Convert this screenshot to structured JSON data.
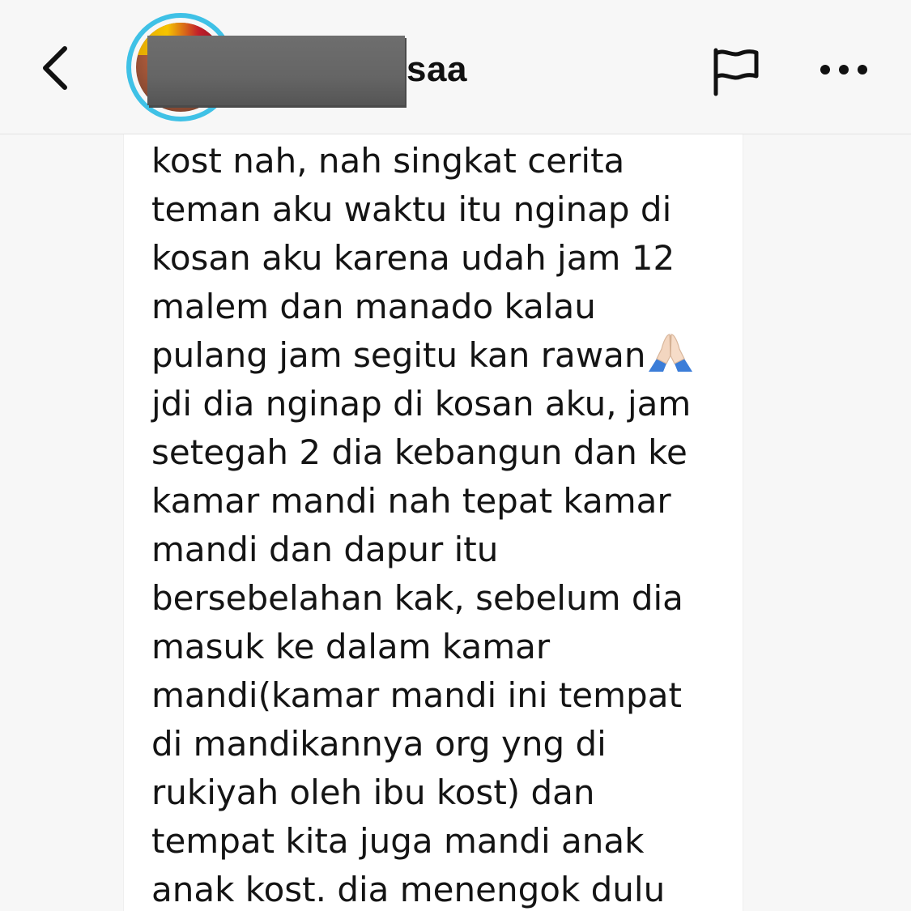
{
  "header": {
    "username_visible_suffix": "saa",
    "back_icon": "chevron-left-icon",
    "flag_icon": "flag-icon",
    "more_icon": "more-horizontal-icon",
    "avatar_ring_color": "#3fc1e6"
  },
  "message": {
    "lines": [
      "kost nah, nah singkat cerita",
      "teman aku waktu itu nginap di",
      "kosan aku karena udah jam 12",
      "malem dan manado kalau",
      "pulang jam segitu kan rawan",
      "jdi dia nginap di kosan aku, jam",
      "setegah 2 dia kebangun dan ke",
      "kamar mandi nah tepat kamar",
      "mandi dan dapur itu",
      "bersebelahan kak, sebelum dia",
      "masuk ke dalam kamar",
      "mandi(kamar mandi ini tempat",
      "di mandikannya org yng di",
      "rukiyah oleh ibu kost) dan",
      "tempat kita juga mandi anak",
      "anak kost. dia menengok dulu"
    ],
    "emoji_after_line_5": "folded-hands-emoji"
  }
}
